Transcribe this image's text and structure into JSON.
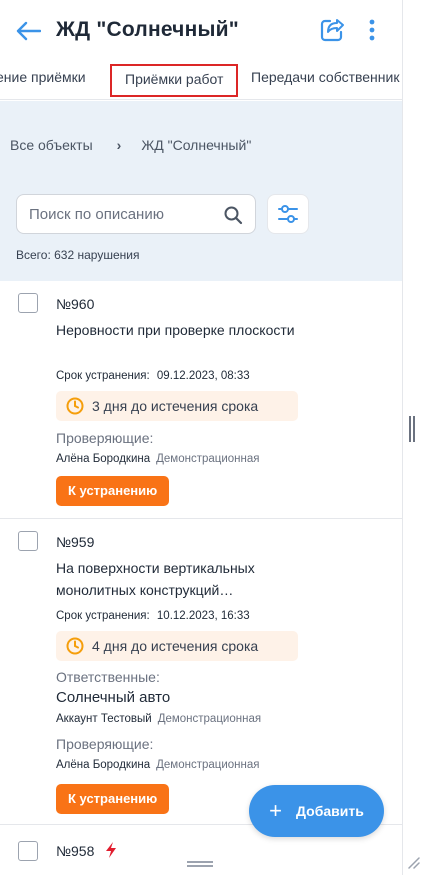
{
  "header": {
    "title": "ЖД \"Солнечный\""
  },
  "tabs": [
    {
      "label": "ение приёмки"
    },
    {
      "label": "Приёмки работ"
    },
    {
      "label": "Передачи собственник"
    }
  ],
  "breadcrumb": {
    "root": "Все объекты",
    "separator": "›",
    "current": "ЖД \"Солнечный\""
  },
  "search": {
    "placeholder": "Поиск по описанию"
  },
  "total_label": "Всего: 632 нарушения",
  "cards": [
    {
      "number": "№960",
      "description": "Неровности при проверке плоскости",
      "deadline_label": "Срок устранения:",
      "deadline_value": "09.12.2023, 08:33",
      "remaining": "3 дня до истечения срока",
      "inspectors_label": "Проверяющие:",
      "inspector_name": "Алёна Бородкина",
      "inspector_org": "Демонстрационная",
      "status": "К устранению"
    },
    {
      "number": "№959",
      "description": "На поверхности вертикальных монолитных конструкций…",
      "deadline_label": "Срок устранения:",
      "deadline_value": "10.12.2023, 16:33",
      "remaining": "4 дня до истечения срока",
      "responsible_label": "Ответственные:",
      "responsible_company": "Солнечный авто",
      "responsible_name": "Аккаунт Тестовый",
      "responsible_org": "Демонстрационная",
      "inspectors_label": "Проверяющие:",
      "inspector_name": "Алёна Бородкина",
      "inspector_org": "Демонстрационная",
      "status": "К устранению"
    },
    {
      "number": "№958"
    }
  ],
  "add_button": {
    "label": "Добавить"
  },
  "colors": {
    "accent": "#3b93e8",
    "status_orange": "#f97316",
    "deadline_bg": "#fef2e8",
    "active_tab_outline": "#dc2626",
    "gray_area": "#eaf1f8",
    "urgent_red": "#e11d2e"
  },
  "icons": [
    "back-arrow-icon",
    "share-icon",
    "more-vertical-icon",
    "search-icon",
    "filter-icon",
    "clock-icon",
    "lightning-icon",
    "plus-icon",
    "scroll-grip-icon",
    "resize-corner-icon"
  ]
}
